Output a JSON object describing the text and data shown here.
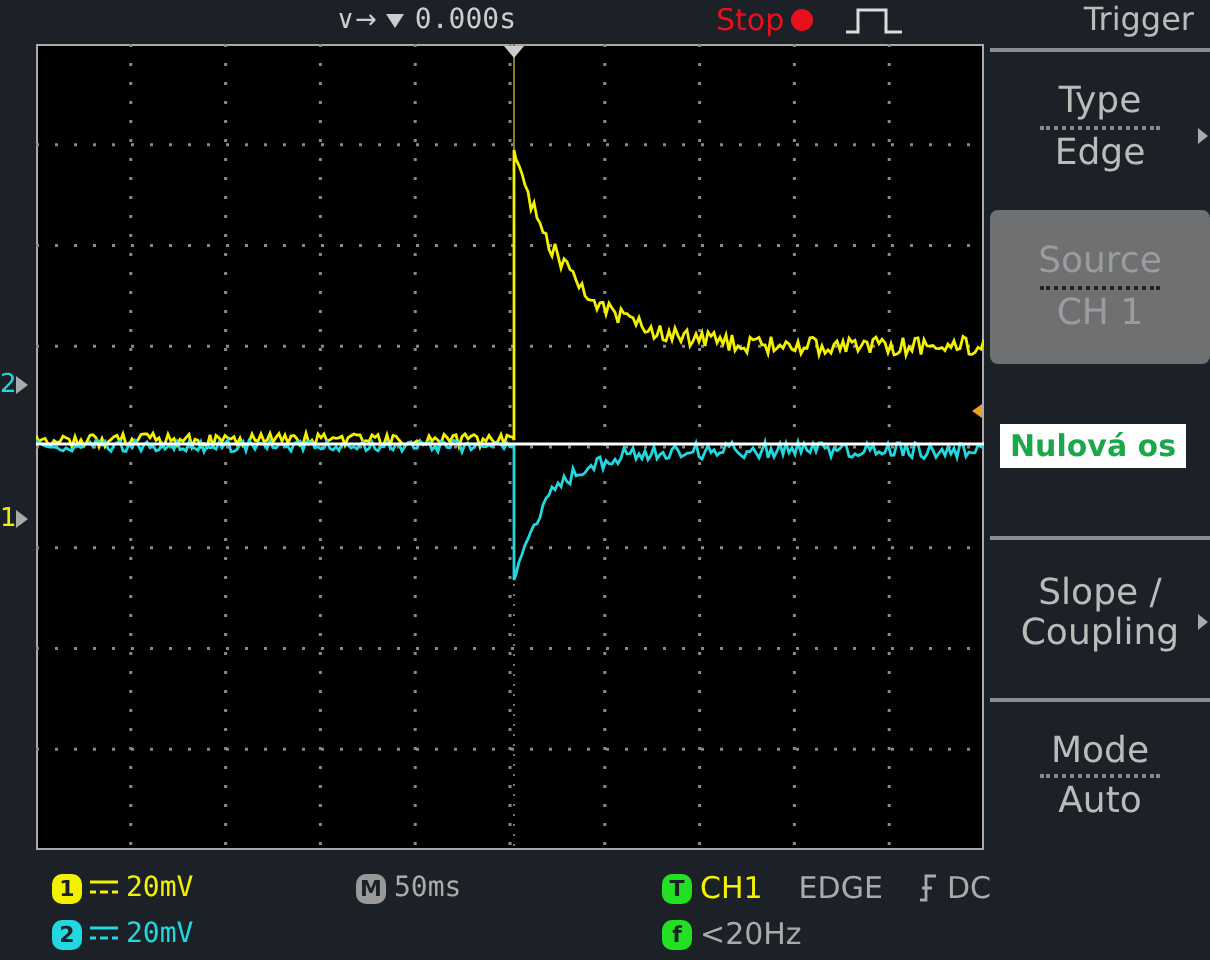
{
  "top_bar": {
    "trigger_arrows": "∨→",
    "position": "0.000s",
    "run_state": "Stop"
  },
  "channel_markers": [
    {
      "label": "2",
      "color": "#22d8e0"
    },
    {
      "label": "1",
      "color": "#f2f200"
    }
  ],
  "annotation": {
    "text": "Nulová os"
  },
  "menu": {
    "title": "Trigger",
    "items": [
      {
        "kind": "pair",
        "title": "Type",
        "value": "Edge",
        "selected": false,
        "submenu": true
      },
      {
        "kind": "pair",
        "title": "Source",
        "value": "CH 1",
        "selected": true,
        "submenu": false
      },
      {
        "kind": "empty",
        "selected": false,
        "submenu": false
      },
      {
        "kind": "single",
        "title": "Slope / Coupling",
        "selected": false,
        "submenu": true
      },
      {
        "kind": "pair",
        "title": "Mode",
        "value": "Auto",
        "selected": false,
        "submenu": false
      }
    ]
  },
  "status": {
    "channels": [
      {
        "number": "1",
        "scale": "20mV",
        "color": "#f2f200"
      },
      {
        "number": "2",
        "scale": "20mV",
        "color": "#22d8e0"
      }
    ],
    "timebase": {
      "badge": "M",
      "value": "50ms"
    },
    "trigger": {
      "badge": "T",
      "source": "CH1",
      "type": "EDGE",
      "coupling": "DC"
    },
    "frequency": {
      "badge": "f",
      "value": "<20Hz"
    }
  }
}
